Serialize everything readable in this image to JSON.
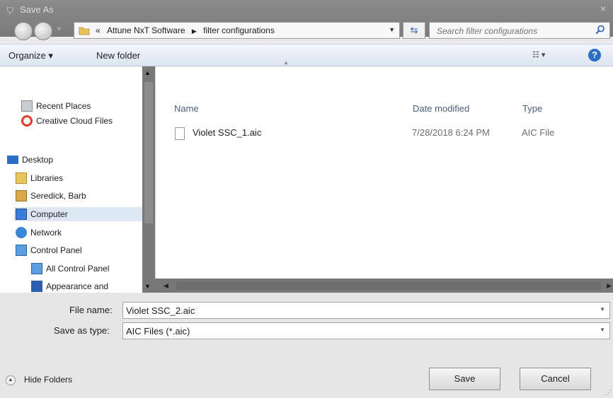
{
  "window": {
    "title": "Save As",
    "close": "×"
  },
  "address": {
    "crumbs": [
      "«",
      "Attune NxT Software",
      "filter configurations"
    ]
  },
  "search": {
    "placeholder": "Search filter configurations"
  },
  "toolbar": {
    "organize": "Organize ▾",
    "new_folder": "New folder",
    "views": "☷ ▾",
    "help": "?"
  },
  "nav": {
    "items": [
      {
        "label": "Recent Places",
        "icon": "recent-places-icon"
      },
      {
        "label": "Creative Cloud Files",
        "icon": "creative-cloud-icon"
      },
      {
        "label": "Desktop",
        "icon": "desktop-icon"
      },
      {
        "label": "Libraries",
        "icon": "libraries-icon"
      },
      {
        "label": "Seredick, Barb",
        "icon": "user-folder-icon"
      },
      {
        "label": "Computer",
        "icon": "computer-icon",
        "selected": true
      },
      {
        "label": "Network",
        "icon": "network-icon"
      },
      {
        "label": "Control Panel",
        "icon": "control-panel-icon"
      },
      {
        "label": "All Control Panel",
        "icon": "control-panel-icon"
      },
      {
        "label": "Appearance and",
        "icon": "appearance-icon"
      }
    ]
  },
  "filelist": {
    "columns": {
      "name": "Name",
      "date": "Date modified",
      "type": "Type"
    },
    "rows": [
      {
        "name": "Violet SSC_1.aic",
        "date": "7/28/2018 6:24 PM",
        "type": "AIC File"
      }
    ]
  },
  "form": {
    "filename_label": "File name:",
    "filename_value": "Violet SSC_2.aic",
    "savetype_label": "Save as type:",
    "savetype_value": "AIC Files (*.aic)"
  },
  "footer": {
    "hide_folders": "Hide Folders",
    "save": "Save",
    "cancel": "Cancel"
  }
}
